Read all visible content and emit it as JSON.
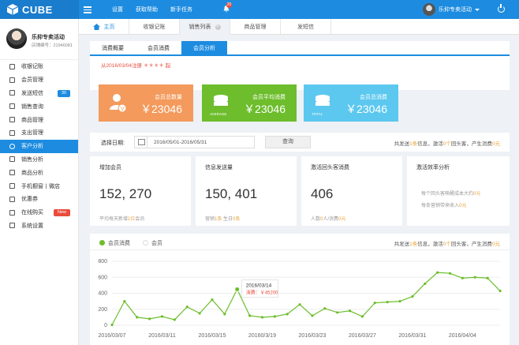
{
  "app": {
    "name": "CUBE"
  },
  "topnav": {
    "items": [
      "设置",
      "获取帮助",
      "新手任务"
    ],
    "bell_count": "20",
    "user": "乐抑专卖活动"
  },
  "sidebar": {
    "profile": {
      "name": "乐抑专卖活动",
      "code": "店铺编号：21946081"
    },
    "items": [
      {
        "label": "收银记账",
        "icon": "cashier-icon"
      },
      {
        "label": "会员管理",
        "icon": "member-icon"
      },
      {
        "label": "发送短信",
        "icon": "sms-icon",
        "badge": "30",
        "badge_color": "#1d8ce0"
      },
      {
        "label": "销售查询",
        "icon": "sales-query-icon"
      },
      {
        "label": "商品管理",
        "icon": "product-icon"
      },
      {
        "label": "支出管理",
        "icon": "expense-icon"
      },
      {
        "label": "客户分析",
        "icon": "customer-analysis-icon",
        "active": true
      },
      {
        "label": "销售分析",
        "icon": "sales-analysis-icon"
      },
      {
        "label": "商品分析",
        "icon": "product-analysis-icon"
      },
      {
        "label": "手机橱窗丨微店",
        "icon": "mobile-icon"
      },
      {
        "label": "优惠券",
        "icon": "coupon-icon"
      },
      {
        "label": "在线购买",
        "icon": "cart-icon",
        "badge": "New",
        "badge_color": "#e84c3d"
      },
      {
        "label": "系统设置",
        "icon": "settings-icon"
      }
    ]
  },
  "tabs": {
    "home": "主页",
    "items": [
      "收银记账",
      "销售列表",
      "商品管理",
      "发短信"
    ]
  },
  "subtabs": [
    "消费概要",
    "会员消费",
    "会员分析"
  ],
  "since_text": "从2016/03/04注册 ＊＊＊＊ 起",
  "cards": [
    {
      "label": "会员总数量",
      "value": "￥23046",
      "color": "#f39a5c",
      "sub": ""
    },
    {
      "label": "会员平均消费",
      "value": "￥23046",
      "color": "#6dbd2c",
      "sub": "AVERAGE"
    },
    {
      "label": "会员总消费",
      "value": "￥23046",
      "color": "#5cc8ef",
      "sub": "TOTAL"
    }
  ],
  "filter": {
    "label": "选择日期:",
    "date_range": "2016/05/01-2016/05/31",
    "button": "查询",
    "summary": {
      "p1": "共发送",
      "n1": "1条",
      "p2": "信息，激活",
      "n2": "0个",
      "p3": "回头客，产生消费",
      "n3": "0元"
    }
  },
  "stats": [
    {
      "title": "增加会员",
      "value": "152, 270",
      "note_a": "平均每天新增",
      "note_hl": "1位",
      "note_b": "会员"
    },
    {
      "title": "信息发送量",
      "value": "150, 401",
      "note_a": "营销",
      "note_hl": "1条",
      "note_b": " 生日",
      "note_hl2": "0条"
    },
    {
      "title": "激活回头客消费",
      "value": "406",
      "note_a": "人数",
      "note_hl": "0",
      "note_b": "人/消费",
      "note_hl2": "0元"
    },
    {
      "title": "激活效率分析",
      "value": "",
      "line1_a": "每个回头客唤醒成本大约",
      "line1_hl": "0元",
      "line2_a": "每条营销带来收入",
      "line2_hl": "0元"
    }
  ],
  "chart_panel": {
    "legend": [
      "会员消费",
      "会员"
    ],
    "legend_colors": [
      "#6dbd2c",
      "#dddddd"
    ],
    "summary": {
      "p1": "共发送",
      "n1": "1条",
      "p2": "信息，激活",
      "n2": "0个",
      "p3": "回头客，产生消费",
      "n3": "0元"
    },
    "tooltip": {
      "date": "2016/03/14",
      "label": "消费：",
      "value": "￥45200"
    }
  },
  "chart_data": {
    "type": "line",
    "ylim": [
      0,
      800
    ],
    "yticks": [
      0,
      200,
      400,
      600,
      800
    ],
    "xtick_labels": [
      "2016/03/07",
      "2016/03/11",
      "2016/03/15",
      "20160/3/19",
      "2016/03/23",
      "2016/03/27",
      "2016/03/31",
      "2016/04/04"
    ],
    "series": [
      {
        "name": "会员消费",
        "color": "#6dbd2c",
        "values": [
          5,
          300,
          100,
          80,
          110,
          70,
          230,
          150,
          320,
          140,
          450,
          120,
          100,
          110,
          140,
          260,
          120,
          210,
          160,
          180,
          110,
          280,
          290,
          300,
          360,
          520,
          660,
          650,
          590,
          600,
          590,
          430
        ]
      }
    ]
  }
}
